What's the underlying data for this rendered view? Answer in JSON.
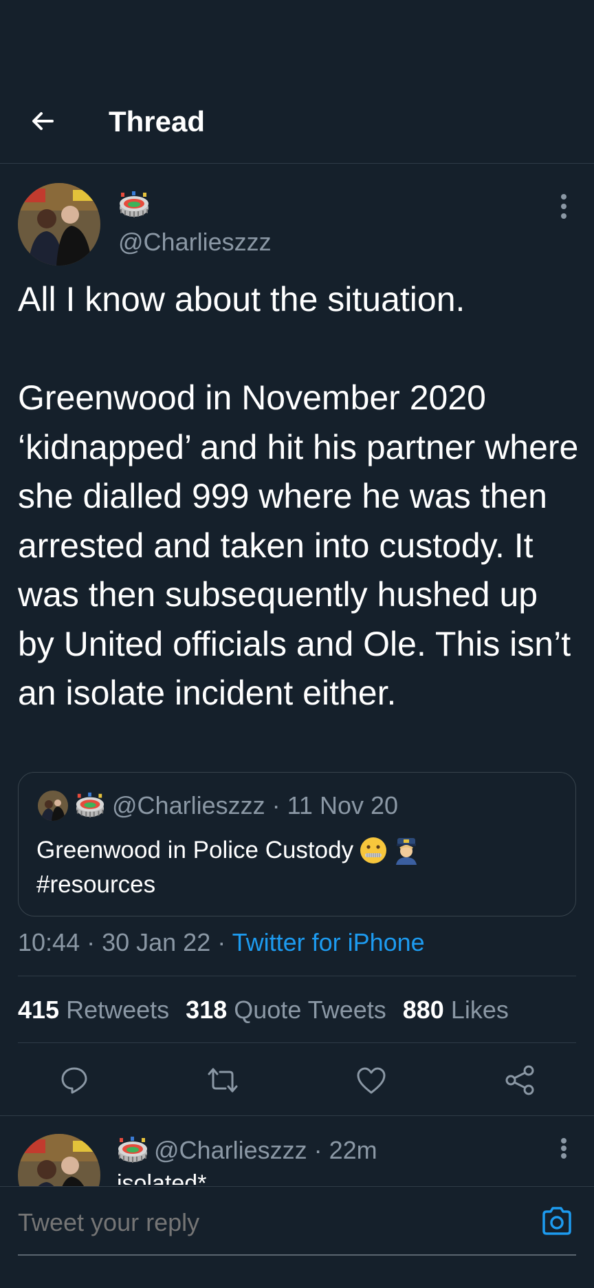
{
  "header": {
    "title": "Thread",
    "back_icon": "arrow-left-icon"
  },
  "tweet": {
    "name_emoji": "stadium-icon",
    "handle": "@Charlieszzz",
    "text": "All I know about the situation.\n\nGreenwood in November 2020 ‘kidnapped’ and hit his partner where she dialled 999 where he was then arrested and taken into custody. It was then subsequently hushed up by United officials and Ole. This isn’t an isolate incident either.",
    "quote": {
      "meta": "@Charlieszzz · 11 Nov 20",
      "text_line1": "Greenwood in Police Custody",
      "text_line2": "#resources",
      "emojis": [
        "zipper-mouth-face-icon",
        "police-officer-icon"
      ]
    },
    "time": "10:44",
    "date": "30 Jan 22",
    "separator": " · ",
    "source": "Twitter for iPhone",
    "stats": {
      "retweets": "415",
      "retweets_label": "Retweets",
      "quotes": "318",
      "quotes_label": "Quote Tweets",
      "likes": "880",
      "likes_label": "Likes"
    },
    "actions": [
      "reply-icon",
      "retweet-icon",
      "like-icon",
      "share-icon"
    ]
  },
  "reply": {
    "meta": "@Charlieszzz · 22m",
    "text": "isolated*"
  },
  "compose": {
    "placeholder": "Tweet your reply",
    "camera_icon": "camera-icon"
  },
  "colors": {
    "background": "#15202b",
    "secondary_text": "#8b98a5",
    "link": "#1d9bf0",
    "border": "#2f3b47"
  }
}
